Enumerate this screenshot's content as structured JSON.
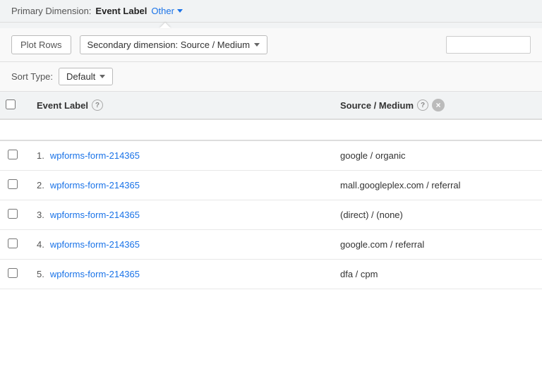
{
  "header": {
    "primary_dimension_label": "Primary Dimension:",
    "primary_dimension_value": "Event Label",
    "other_label": "Other"
  },
  "controls": {
    "plot_rows_label": "Plot Rows",
    "secondary_dim_label": "Secondary dimension: Source / Medium",
    "search_placeholder": ""
  },
  "sort": {
    "sort_type_label": "Sort Type:",
    "sort_default": "Default"
  },
  "table": {
    "columns": [
      {
        "label": "Event Label",
        "has_help": true,
        "has_close": false
      },
      {
        "label": "Source / Medium",
        "has_help": true,
        "has_close": true
      }
    ],
    "rows": [
      {
        "num": "1.",
        "value": "wpforms-form-214365",
        "source": "google / organic"
      },
      {
        "num": "2.",
        "value": "wpforms-form-214365",
        "source": "mall.googleplex.com / referral"
      },
      {
        "num": "3.",
        "value": "wpforms-form-214365",
        "source": "(direct) / (none)"
      },
      {
        "num": "4.",
        "value": "wpforms-form-214365",
        "source": "google.com / referral"
      },
      {
        "num": "5.",
        "value": "wpforms-form-214365",
        "source": "dfa / cpm"
      }
    ]
  }
}
